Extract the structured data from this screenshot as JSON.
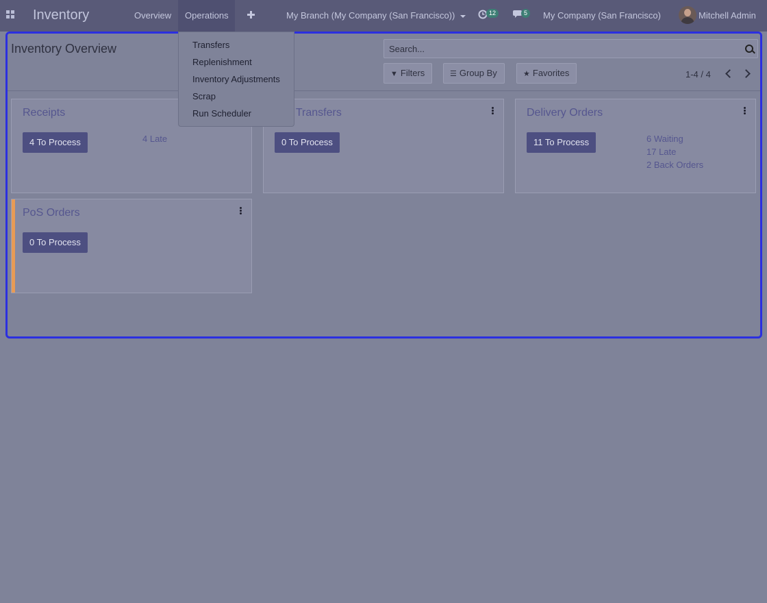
{
  "navbar": {
    "app_name": "Inventory",
    "menu": [
      "Overview",
      "Operations"
    ],
    "branch": "My Branch (My Company (San Francisco))",
    "activity_count": "12",
    "message_count": "5",
    "company": "My Company (San Francisco)",
    "user": "Mitchell Admin"
  },
  "control_panel": {
    "title": "Inventory Overview",
    "search_placeholder": "Search...",
    "filters_label": "Filters",
    "groupby_label": "Group By",
    "favorites_label": "Favorites",
    "pager": "1-4 / 4"
  },
  "operations_menu": [
    "Transfers",
    "Replenishment",
    "Inventory Adjustments",
    "Scrap",
    "Run Scheduler"
  ],
  "cards": [
    {
      "title": "Receipts",
      "button": "4 To Process",
      "stats": [
        "4 Late"
      ]
    },
    {
      "title": "rnal Transfers",
      "button": "0 To Process",
      "stats": []
    },
    {
      "title": "Delivery Orders",
      "button": "11 To Process",
      "stats": [
        "6 Waiting",
        "17 Late",
        "2 Back Orders"
      ]
    },
    {
      "title": "PoS Orders",
      "button": "0 To Process",
      "stats": []
    }
  ],
  "colors": {
    "navbar": "#595a78",
    "accent_button": "#4d4f81",
    "focus_border": "#2b2fe0",
    "pos_color_tag": "#e89b55"
  },
  "icons": [
    "apps-grid-icon",
    "plus-icon",
    "activity-clock-icon",
    "chat-icon",
    "search-icon",
    "filter-icon",
    "list-icon",
    "star-icon",
    "chevron-left-icon",
    "chevron-right-icon",
    "kebab-menu-icon"
  ]
}
